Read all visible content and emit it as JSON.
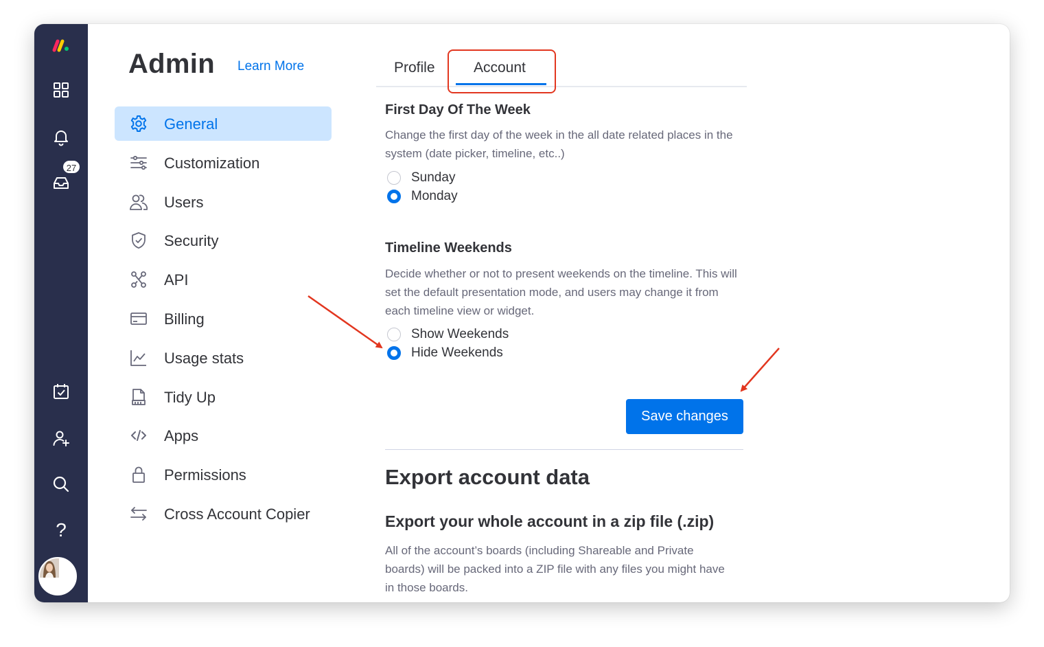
{
  "brand": {
    "logo_colors": [
      "#fb275d",
      "#ffcc00",
      "#00ca72"
    ]
  },
  "rail": {
    "items": [
      {
        "icon": "grid-icon"
      },
      {
        "icon": "bell-icon"
      },
      {
        "icon": "inbox-icon",
        "badge": "27"
      },
      {
        "icon": "calendar-check-icon"
      },
      {
        "icon": "add-user-icon"
      },
      {
        "icon": "search-icon"
      },
      {
        "icon": "help-icon",
        "glyph": "?"
      }
    ],
    "avatar": "avatar"
  },
  "header": {
    "title": "Admin",
    "learn_more": "Learn More"
  },
  "sidebar": {
    "items": [
      {
        "label": "General",
        "icon": "gear-icon",
        "active": true
      },
      {
        "label": "Customization",
        "icon": "sliders-icon"
      },
      {
        "label": "Users",
        "icon": "users-icon"
      },
      {
        "label": "Security",
        "icon": "shield-icon"
      },
      {
        "label": "API",
        "icon": "api-icon"
      },
      {
        "label": "Billing",
        "icon": "credit-card-icon"
      },
      {
        "label": "Usage stats",
        "icon": "chart-icon"
      },
      {
        "label": "Tidy Up",
        "icon": "broom-icon"
      },
      {
        "label": "Apps",
        "icon": "code-icon"
      },
      {
        "label": "Permissions",
        "icon": "lock-icon"
      },
      {
        "label": "Cross Account Copier",
        "icon": "transfer-arrows-icon"
      }
    ]
  },
  "tabs": [
    {
      "label": "Profile"
    },
    {
      "label": "Account",
      "active": true
    }
  ],
  "first_day": {
    "title": "First Day Of The Week",
    "description": "Change the first day of the week in the all date related places in the system (date picker, timeline, etc..)",
    "options": [
      {
        "label": "Sunday",
        "checked": false
      },
      {
        "label": "Monday",
        "checked": true
      }
    ]
  },
  "timeline_weekends": {
    "title": "Timeline Weekends",
    "description": "Decide whether or not to present weekends on the timeline. This will set the default presentation mode, and users may change it from each timeline view or widget.",
    "options": [
      {
        "label": "Show Weekends",
        "checked": false
      },
      {
        "label": "Hide Weekends",
        "checked": true
      }
    ]
  },
  "save_label": "Save changes",
  "export": {
    "title": "Export account data",
    "subtitle": "Export your whole account in a zip file (.zip)",
    "description": "All of the account’s boards (including Shareable and Private boards) will be packed into a ZIP file with any files you might have in those boards."
  },
  "colors": {
    "accent": "#0073ea",
    "rail_bg": "#292f4c",
    "active_nav_bg": "#cce5ff",
    "annotation_red": "#e2361f"
  }
}
